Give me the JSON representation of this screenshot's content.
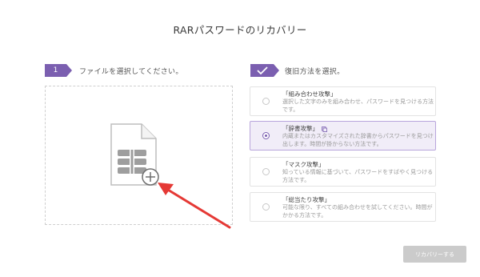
{
  "window": {
    "title": "RARパスワードのリカバリー"
  },
  "step1": {
    "number": "1",
    "label": "ファイルを選択してください。"
  },
  "step2": {
    "label": "復旧方法を選択。"
  },
  "methods": [
    {
      "name": "「組み合わせ攻撃」",
      "description": "選択した文字のみを組み合わせ、パスワードを見つける方法です。",
      "selected": false
    },
    {
      "name": "「辞書攻撃」",
      "description": "内蔵またはカスタマイズされた辞書からパスワードを見つけ出します。時間が掛からない方法です。",
      "selected": true
    },
    {
      "name": "「マスク攻撃」",
      "description": "知っている情報に基づいて、パスワードをすばやく見つける方法です。",
      "selected": false
    },
    {
      "name": "「総当たり攻撃」",
      "description": "可能な限り、すべての組み合わせを試してください。時間がかかる方法です。",
      "selected": false
    }
  ],
  "actions": {
    "recover_label": "リカバリーする"
  },
  "colors": {
    "accent": "#7b5fb0",
    "arrow": "#e53935",
    "button_disabled": "#cbcbcb"
  }
}
